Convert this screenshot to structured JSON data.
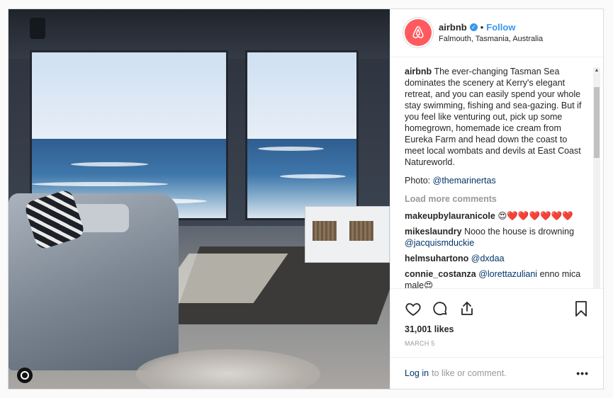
{
  "post": {
    "username": "airbnb",
    "follow_label": "Follow",
    "separator": "•",
    "location": "Falmouth, Tasmania, Australia",
    "caption_user": "airbnb",
    "caption_text": "The ever-changing Tasman Sea dominates the scenery at Kerry's elegant retreat, and you can easily spend your whole stay swimming, fishing and sea-gazing. But if you feel like venturing out, pick up some homegrown, homemade ice cream from Eureka Farm and head down the coast to meet local wombats and devils at East Coast Natureworld.",
    "photo_credit_label": "Photo:",
    "photo_credit_handle": "@themarinertas",
    "load_more": "Load more comments",
    "likes": "31,001 likes",
    "date": "MARCH 5"
  },
  "comments": [
    {
      "user": "makeupbylauranicole",
      "text": "😍❤️❤️❤️❤️❤️❤️"
    },
    {
      "user": "mikeslaundry",
      "text": "Nooo the house is drowning",
      "mention": "@jacquismduckie"
    },
    {
      "user": "helmsuhartono",
      "text": "",
      "mention": "@dxdaa"
    },
    {
      "user": "connie_costanza",
      "text": "enno mica male😍",
      "mention": "@lorettazuliani"
    }
  ],
  "footer": {
    "login_label": "Log in",
    "login_rest": "to like or comment.",
    "more_label": "•••"
  },
  "icons": {
    "like": "heart-icon",
    "comment": "comment-icon",
    "share": "share-icon",
    "save": "bookmark-icon",
    "verified": "verified-badge-icon",
    "user_tag": "user-tag-icon"
  },
  "colors": {
    "brand": "#ff5a5f",
    "link": "#3897f0",
    "mention": "#003569",
    "muted": "#999999"
  }
}
